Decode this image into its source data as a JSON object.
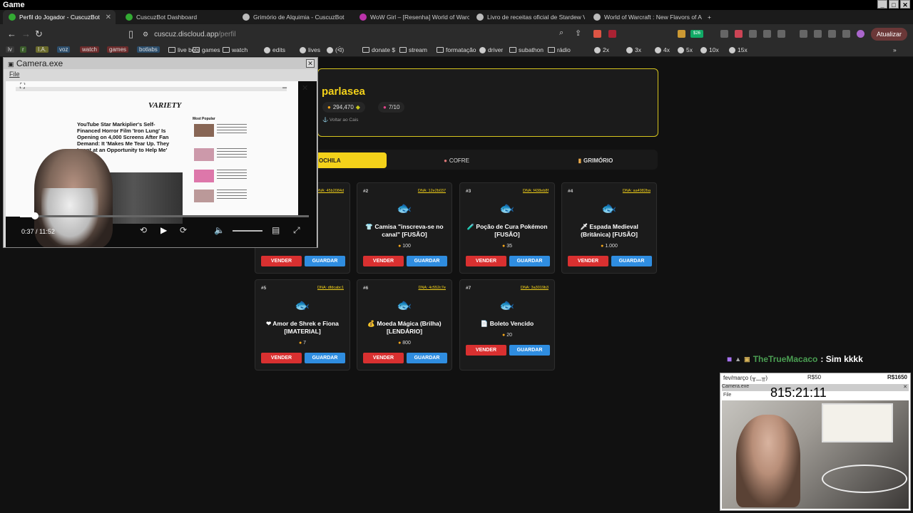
{
  "window": {
    "title": "Game"
  },
  "tabs": [
    {
      "label": "Perfil do Jogador - CuscuzBot",
      "active": true
    },
    {
      "label": "CuscuzBot Dashboard",
      "active": false
    },
    {
      "label": "Grimório de Alquimia - CuscuzBot",
      "active": false
    },
    {
      "label": "WoW Girl – [Resenha] World of Warc",
      "active": false
    },
    {
      "label": "Livro de receitas oficial de Stardew V",
      "active": false
    },
    {
      "label": "World of Warcraft : New Flavors of A",
      "active": false
    }
  ],
  "urlbar": {
    "domain": "cuscuz.discloud.app",
    "path": "/perfil",
    "update_label": "Atualizar",
    "badge": "$26"
  },
  "bookmarks": [
    {
      "label": "lv",
      "kind": "chip",
      "color": "#3a3a3a"
    },
    {
      "label": "r",
      "kind": "chip",
      "color": "#3b5d2b"
    },
    {
      "label": "I.A.",
      "kind": "chip",
      "color": "#6b6b2b"
    },
    {
      "label": "voz",
      "kind": "chip",
      "color": "#2b4d6b"
    },
    {
      "label": "watch",
      "kind": "chip",
      "color": "#6b2b2b"
    },
    {
      "label": "games",
      "kind": "chip",
      "color": "#6b2b2b"
    },
    {
      "label": "botlabs",
      "kind": "chip",
      "color": "#2b4d6b"
    },
    {
      "label": "live bots",
      "kind": "folder"
    },
    {
      "label": "games",
      "kind": "folder"
    },
    {
      "label": "watch",
      "kind": "folder"
    },
    {
      "label": "edits",
      "kind": "icon"
    },
    {
      "label": "lives",
      "kind": "icon"
    },
    {
      "label": "(ᐛ⁠)",
      "kind": "icon"
    },
    {
      "label": "donate $",
      "kind": "folder"
    },
    {
      "label": "stream",
      "kind": "folder"
    },
    {
      "label": "formatação",
      "kind": "folder"
    },
    {
      "label": "driver",
      "kind": "icon"
    },
    {
      "label": "subathon",
      "kind": "folder"
    },
    {
      "label": "rádio",
      "kind": "folder"
    },
    {
      "label": "2x",
      "kind": "icon"
    },
    {
      "label": "3x",
      "kind": "icon"
    },
    {
      "label": "4x",
      "kind": "icon"
    },
    {
      "label": "5x",
      "kind": "icon"
    },
    {
      "label": "10x",
      "kind": "icon"
    },
    {
      "label": "15x",
      "kind": "icon"
    }
  ],
  "profile": {
    "username": "parlasea",
    "coins": "294,470",
    "level": "7/10",
    "back_link": "Voltar ao Cais"
  },
  "profile_tabs": [
    {
      "label": "OCHILA",
      "active": true
    },
    {
      "label": "COFRE",
      "active": false
    },
    {
      "label": "GRIMÓRIO",
      "active": false
    }
  ],
  "inventory": [
    {
      "num": "",
      "dna": "DNA: 45b2084d",
      "emoji": "",
      "name": "o Vazio",
      "price": ""
    },
    {
      "num": "#2",
      "dna": "DNA: 12e2b037",
      "emoji": "👕",
      "name": "Camisa \"inscreva-se no canal\" [FUSÃO]",
      "price": "100"
    },
    {
      "num": "#3",
      "dna": "DNA: f438eb8f",
      "emoji": "🧪",
      "name": "Poção de Cura Pokémon [FUSÃO]",
      "price": "35"
    },
    {
      "num": "#4",
      "dna": "DNA: aa4982ba",
      "emoji": "🗡",
      "name": "Espada Medieval (Britânica) [FUSÃO]",
      "price": "1.000"
    },
    {
      "num": "#5",
      "dna": "DNA: dfdcabc1",
      "emoji": "❤",
      "name": "Amor de Shrek e Fiona [IMATERIAL]",
      "price": "7"
    },
    {
      "num": "#6",
      "dna": "DNA: 4c552c7e",
      "emoji": "💰",
      "name": "Moeda Mágica (Brilha) [LENDÁRIO]",
      "price": "800"
    },
    {
      "num": "#7",
      "dna": "DNA: 3a3019b3",
      "emoji": "📄",
      "name": "Boleto Vencido",
      "price": "20"
    }
  ],
  "buttons": {
    "sell": "VENDER",
    "keep": "GUARDAR"
  },
  "camera": {
    "title": "Camera.exe",
    "menu": "File",
    "article_site": "VARIETY",
    "headline": "YouTube Star Markiplier's Self-Financed Horror Film 'Iron Lung' Is Opening on 4,000 Screens After Fan Demand: It 'Makes Me Tear Up. They Leapt at an Opportunity to Help Me'",
    "most_popular": "Most Popular",
    "time": "0:37 / 11:52",
    "progress": 0.053
  },
  "chat": {
    "user": "TheTrueMacaco",
    "message": ": Sim kkkk"
  },
  "cam2": {
    "header_left": "fev/março (╥﹏╥)",
    "header_mid": "R$50",
    "header_right": "R$1650",
    "window_title": "Camera.exe",
    "clock": "815:21:11",
    "menu": "File"
  }
}
